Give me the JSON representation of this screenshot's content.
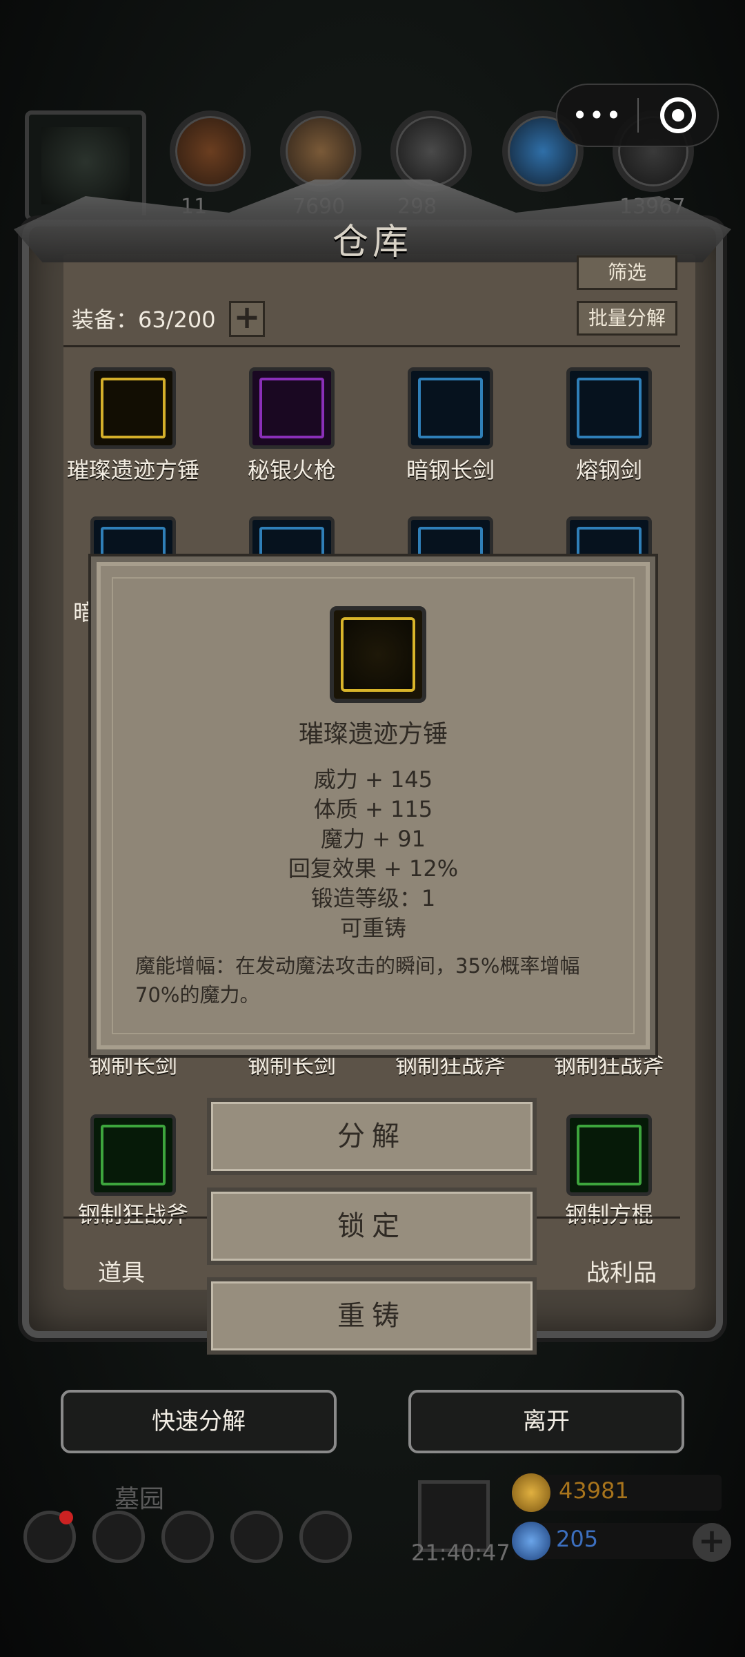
{
  "panel_title": "仓库",
  "buttons": {
    "filter": "筛选",
    "batch_decompose": "批量分解"
  },
  "equip_count": "装备：63/200",
  "expand_symbol": "+",
  "top_resources": [
    "11",
    "7690",
    "298",
    "",
    "13967"
  ],
  "items": [
    {
      "name": "璀璨遗迹方锤",
      "quality": "#d4af2a"
    },
    {
      "name": "秘银火枪",
      "quality": "#8a2fb8"
    },
    {
      "name": "暗钢长剑",
      "quality": "#2f7fb8"
    },
    {
      "name": "熔钢剑",
      "quality": "#2f7fb8"
    },
    {
      "name": "暗",
      "quality": "#2f7fb8"
    },
    {
      "name": "钢制长剑",
      "quality": "#2f7fb8"
    },
    {
      "name": "钢制长剑",
      "quality": "#2f7fb8"
    },
    {
      "name": "钢制狂战斧",
      "quality": "#2f7fb8"
    },
    {
      "name": "钢制狂战斧",
      "quality": "#2f7fb8"
    },
    {
      "name": "钢制狂战斧",
      "quality": "#3da53d"
    },
    {
      "name": "钢制方棍",
      "quality": "#3da53d"
    }
  ],
  "tabs": {
    "props": "道具",
    "loot": "战利品"
  },
  "popup": {
    "name": "璀璨遗迹方锤",
    "stats": [
      "威力 + 145",
      "体质 + 115",
      "魔力 + 91",
      "回复效果 + 12%",
      "锻造等级：1",
      "可重铸"
    ],
    "description": "魔能增幅：在发动魔法攻击的瞬间，35%概率增幅70%的魔力。"
  },
  "actions": {
    "decompose": "分解",
    "lock": "锁定",
    "reforge": "重铸"
  },
  "bottom": {
    "quick_decompose": "快速分解",
    "leave": "离开"
  },
  "hud": {
    "location": "墓园",
    "time": "21:40:47",
    "gold": "43981",
    "gems": "205",
    "gold_color": "#c08a1e",
    "gem_color": "#3c6fbf"
  }
}
